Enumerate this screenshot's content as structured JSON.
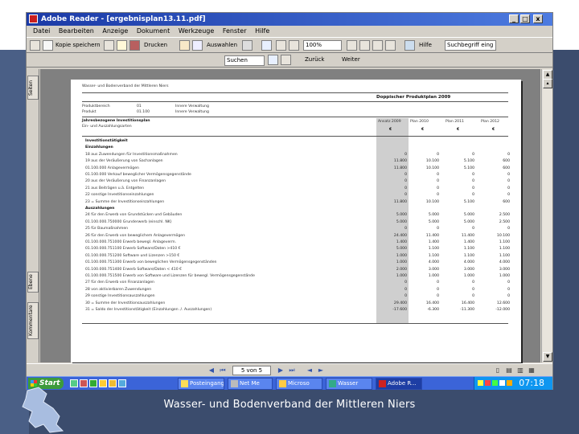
{
  "window": {
    "title": "Adobe Reader - [ergebnisplan13.11.pdf]",
    "min_label": "_",
    "restore_label": "□",
    "close_label": "x"
  },
  "menu": [
    "Datei",
    "Bearbeiten",
    "Anzeige",
    "Dokument",
    "Werkzeuge",
    "Fenster",
    "Hilfe"
  ],
  "toolbar": {
    "save_label": "Kopie speichern",
    "print_label": "Drucken",
    "select_label": "Auswahlen",
    "zoom_value": "100%",
    "help_label": "Hilfe",
    "find_label": "Suchen",
    "search_placeholder": "Suchbegriff eing",
    "back_label": "Zurück",
    "forward_label": "Weiter"
  },
  "sidebar": {
    "tab_pages": "Seiten",
    "tab_layers": "Ebene",
    "tab_comments": "Kommentare"
  },
  "statusbar": {
    "page_indicator": "5 von 5"
  },
  "document": {
    "org": "Wasser- und Bodenverband der Mittleren Niers",
    "plan_title": "Doppischer Produktplan 2009",
    "meta": [
      {
        "k": "Produktbereich",
        "v1": "01",
        "v2": "Innere Verwaltung"
      },
      {
        "k": "Produkt",
        "v1": "01.100",
        "v2": "Innere Verwaltung"
      }
    ],
    "col_header_left": "Jahresbezogene Investitionsplan",
    "col_header_left2": "Ein- und Auszahlungsarten",
    "columns": [
      "Ansatz 2009",
      "Plan 2010",
      "Plan 2011",
      "Plan 2012"
    ],
    "col_units": [
      "€",
      "€",
      "€",
      "€"
    ],
    "rows": [
      {
        "label": "Investitionstätigkeit",
        "vals": [
          "",
          "",
          "",
          ""
        ],
        "bold": true
      },
      {
        "label": "Einzahlungen",
        "vals": [
          "",
          "",
          "",
          ""
        ],
        "bold": true
      },
      {
        "label": "18 aus Zuwendungen für Investitionsmaßnahmen",
        "vals": [
          "0",
          "0",
          "0",
          "0"
        ]
      },
      {
        "label": "19 aus der Veräußerung von Sachanlagen",
        "vals": [
          "11.800",
          "10.100",
          "5.100",
          "600"
        ]
      },
      {
        "label": "01.100.000   Anlagevermögen",
        "vals": [
          "11.800",
          "10.100",
          "5.100",
          "600"
        ]
      },
      {
        "label": "01.100.000   Verkauf beweglicher Vermögensgegenstände",
        "vals": [
          "0",
          "0",
          "0",
          "0"
        ]
      },
      {
        "label": "20 aus der Veräußerung von Finanzanlagen",
        "vals": [
          "0",
          "0",
          "0",
          "0"
        ]
      },
      {
        "label": "21 aus Beiträgen u.ä. Entgelten",
        "vals": [
          "0",
          "0",
          "0",
          "0"
        ]
      },
      {
        "label": "22 sonstige Investitionseinzahlungen",
        "vals": [
          "0",
          "0",
          "0",
          "0"
        ]
      },
      {
        "label": "23 = Summe der Investitionseinzahlungen",
        "vals": [
          "11.800",
          "10.100",
          "5.100",
          "600"
        ]
      },
      {
        "label": "Auszahlungen",
        "vals": [
          "",
          "",
          "",
          ""
        ],
        "bold": true
      },
      {
        "label": "24 für den Erwerb von Grundstücken und Gebäuden",
        "vals": [
          "5.000",
          "5.000",
          "5.000",
          "2.500"
        ]
      },
      {
        "label": "01.100.000.750000   Grunderwerb (einschl. NK)",
        "vals": [
          "5.000",
          "5.000",
          "5.000",
          "2.500"
        ]
      },
      {
        "label": "25 für Baumaßnahmen",
        "vals": [
          "0",
          "0",
          "0",
          "0"
        ]
      },
      {
        "label": "26 für den Erwerb von beweglichem Anlagevermögen",
        "vals": [
          "24.400",
          "11.400",
          "11.400",
          "10.100"
        ]
      },
      {
        "label": "01.100.000.751000   Erwerb bewegl. Anlageverm.",
        "vals": [
          "1.400",
          "1.400",
          "1.400",
          "1.100"
        ]
      },
      {
        "label": "01.100.000.751100   Erwerb Software/Daten >410 €",
        "vals": [
          "5.000",
          "1.100",
          "1.100",
          "1.100"
        ]
      },
      {
        "label": "01.100.000.751200   Software und Lizenzen >150 €",
        "vals": [
          "1.000",
          "1.100",
          "1.100",
          "1.100"
        ]
      },
      {
        "label": "01.100.000.751300   Erwerb von beweglichen Vermögensgegenständen",
        "vals": [
          "1.000",
          "4.000",
          "4.000",
          "4.000"
        ]
      },
      {
        "label": "01.100.000.751400   Erwerb Software/Daten < 410 €",
        "vals": [
          "2.000",
          "3.000",
          "3.000",
          "3.000"
        ]
      },
      {
        "label": "01.100.000.751500   Erwerb von Software und Lizenzen für bewegl. Vermögensgegenstände",
        "vals": [
          "1.000",
          "1.000",
          "1.000",
          "1.000"
        ]
      },
      {
        "label": "27 für den Erwerb von Finanzanlagen",
        "vals": [
          "0",
          "0",
          "0",
          "0"
        ]
      },
      {
        "label": "28 von aktivierbaren Zuwendungen",
        "vals": [
          "0",
          "0",
          "0",
          "0"
        ]
      },
      {
        "label": "29 sonstige Investitionsauszahlungen",
        "vals": [
          "0",
          "0",
          "0",
          "0"
        ]
      },
      {
        "label": "30 = Summe der Investitionsauszahlungen",
        "vals": [
          "29.400",
          "16.400",
          "16.400",
          "12.600"
        ]
      },
      {
        "label": "31 = Saldo der Investitionstätigkeit (Einzahlungen ./. Auszahlungen)",
        "vals": [
          "-17.600",
          "-6.300",
          "-11.300",
          "-12.000"
        ]
      }
    ]
  },
  "taskbar": {
    "start_label": "Start",
    "buttons": [
      "Posteingang",
      "Net Me",
      "Microso",
      "Wasser",
      "Adobe R..."
    ],
    "active_index": 4,
    "clock": "07:18"
  },
  "footer_text": "Wasser- und Bodenverband der Mittleren Niers",
  "colors": {
    "titlebar": "#1b3aa6",
    "taskbar": "#3b64d8",
    "slide_bg": "#3b4c6d"
  }
}
